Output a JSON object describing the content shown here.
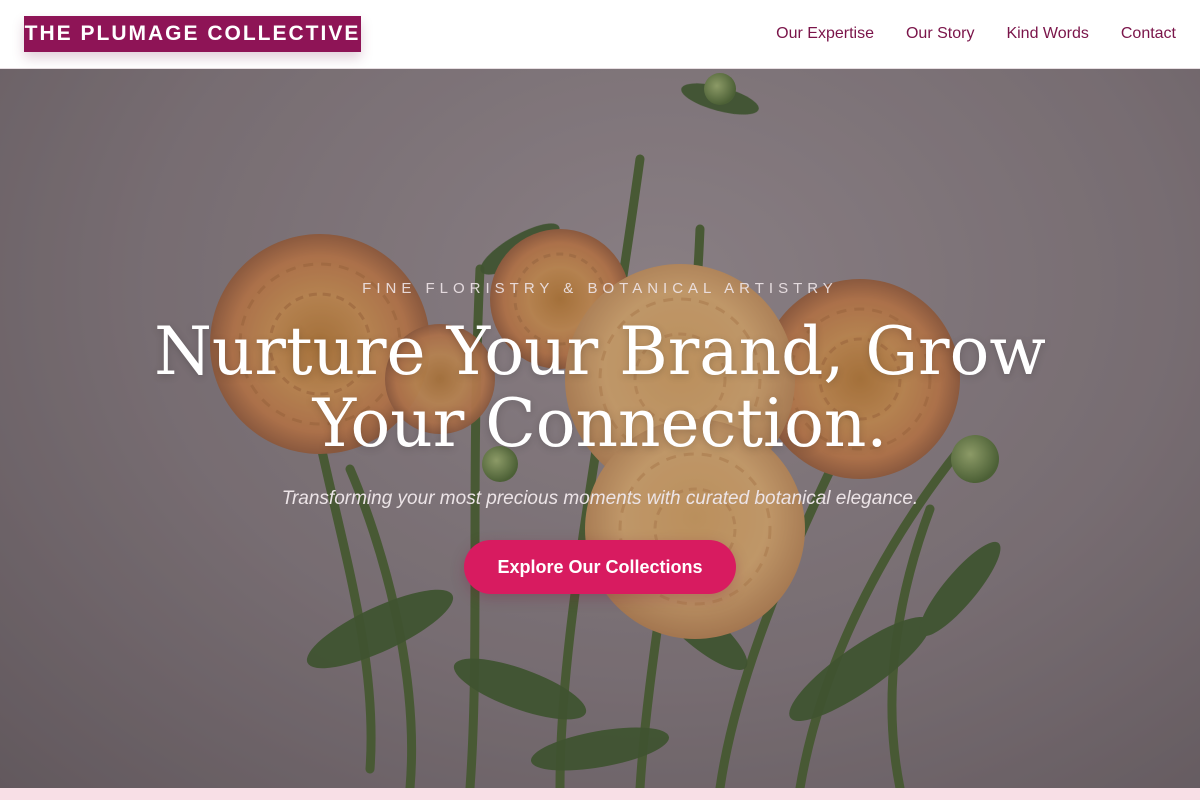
{
  "header": {
    "logo_text": "THE PLUMAGE COLLECTIVE",
    "nav": [
      {
        "label": "Our Expertise"
      },
      {
        "label": "Our Story"
      },
      {
        "label": "Kind Words"
      },
      {
        "label": "Contact"
      }
    ]
  },
  "hero": {
    "eyebrow": "FINE FLORISTRY & BOTANICAL ARTISTRY",
    "headline_line1": "Nurture Your Brand, Grow",
    "headline_line2": "Your Connection.",
    "subline": "Transforming your most precious moments with curated botanical elegance.",
    "cta_label": "Explore Our Collections"
  },
  "colors": {
    "brand": "#8e1456",
    "nav_text": "#7a1449",
    "cta": "#d81b60",
    "footer_strip": "#f8dfe6"
  }
}
